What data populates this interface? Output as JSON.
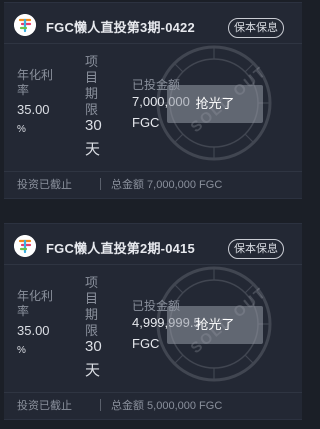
{
  "products": [
    {
      "title": "FGC懒人直投第3期-0422",
      "badge": "保本保息",
      "rate_label": "年化利率",
      "rate_value": "35.00",
      "rate_unit": "%",
      "term_label": "项目期限",
      "term_value": "30",
      "term_unit": "天",
      "invested_label": "已投金额",
      "invested_value": "7,000,000",
      "invested_unit": "FGC",
      "sold_out_label": "抢光了",
      "status": "投资已截止",
      "total_amount": "总金额 7,000,000 FGC"
    },
    {
      "title": "FGC懒人直投第2期-0415",
      "badge": "保本保息",
      "rate_label": "年化利率",
      "rate_value": "35.00",
      "rate_unit": "%",
      "term_label": "项目期限",
      "term_value": "30",
      "term_unit": "天",
      "invested_label": "已投金额",
      "invested_value": "4,999,999.5",
      "invested_unit": "FGC",
      "sold_out_label": "抢光了",
      "status": "投资已截止",
      "total_amount": "总金额 5,000,000 FGC"
    }
  ],
  "stamp_text": "SOLD OUT",
  "colors": {
    "background": "#1b1f27",
    "card": "#232834",
    "muted_text": "#8a909c",
    "primary_text": "#e7e9ee",
    "sold_button": "#969ba5"
  }
}
